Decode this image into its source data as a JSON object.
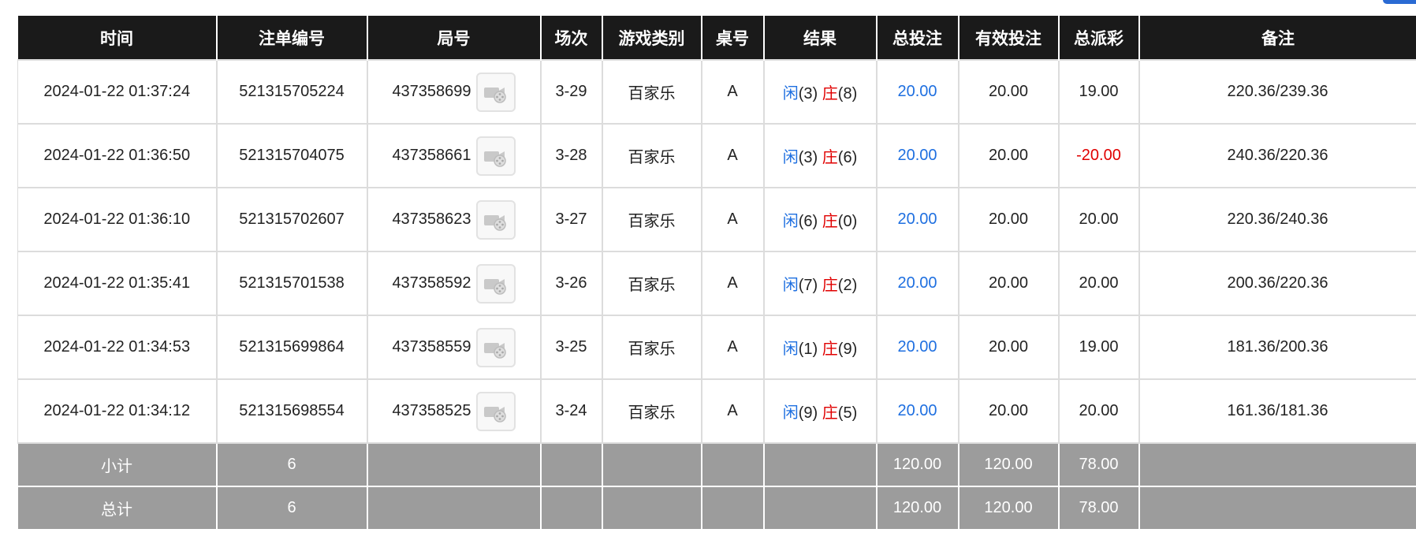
{
  "headers": [
    "时间",
    "注单编号",
    "局号",
    "场次",
    "游戏类别",
    "桌号",
    "结果",
    "总投注",
    "有效投注",
    "总派彩",
    "备注"
  ],
  "result_labels": {
    "player": "闲",
    "banker": "庄"
  },
  "colors": {
    "accent_blue": "#1e6fe0",
    "negative_red": "#e00000",
    "header_bg": "#1a1a1a",
    "total_bg": "#9c9c9c"
  },
  "rows": [
    {
      "time": "2024-01-22 01:37:24",
      "bet_id": "521315705224",
      "round_id": "437358699",
      "shoe": "3-29",
      "game_type": "百家乐",
      "table": "A",
      "player_score": "(3)",
      "banker_score": "(8)",
      "total_bet": "20.00",
      "valid_bet": "20.00",
      "payout": "19.00",
      "payout_negative": false,
      "remark": "220.36/239.36"
    },
    {
      "time": "2024-01-22 01:36:50",
      "bet_id": "521315704075",
      "round_id": "437358661",
      "shoe": "3-28",
      "game_type": "百家乐",
      "table": "A",
      "player_score": "(3)",
      "banker_score": "(6)",
      "total_bet": "20.00",
      "valid_bet": "20.00",
      "payout": "-20.00",
      "payout_negative": true,
      "remark": "240.36/220.36"
    },
    {
      "time": "2024-01-22 01:36:10",
      "bet_id": "521315702607",
      "round_id": "437358623",
      "shoe": "3-27",
      "game_type": "百家乐",
      "table": "A",
      "player_score": "(6)",
      "banker_score": "(0)",
      "total_bet": "20.00",
      "valid_bet": "20.00",
      "payout": "20.00",
      "payout_negative": false,
      "remark": "220.36/240.36"
    },
    {
      "time": "2024-01-22 01:35:41",
      "bet_id": "521315701538",
      "round_id": "437358592",
      "shoe": "3-26",
      "game_type": "百家乐",
      "table": "A",
      "player_score": "(7)",
      "banker_score": "(2)",
      "total_bet": "20.00",
      "valid_bet": "20.00",
      "payout": "20.00",
      "payout_negative": false,
      "remark": "200.36/220.36"
    },
    {
      "time": "2024-01-22 01:34:53",
      "bet_id": "521315699864",
      "round_id": "437358559",
      "shoe": "3-25",
      "game_type": "百家乐",
      "table": "A",
      "player_score": "(1)",
      "banker_score": "(9)",
      "total_bet": "20.00",
      "valid_bet": "20.00",
      "payout": "19.00",
      "payout_negative": false,
      "remark": "181.36/200.36"
    },
    {
      "time": "2024-01-22 01:34:12",
      "bet_id": "521315698554",
      "round_id": "437358525",
      "shoe": "3-24",
      "game_type": "百家乐",
      "table": "A",
      "player_score": "(9)",
      "banker_score": "(5)",
      "total_bet": "20.00",
      "valid_bet": "20.00",
      "payout": "20.00",
      "payout_negative": false,
      "remark": "161.36/181.36"
    }
  ],
  "subtotal": {
    "label": "小计",
    "count": "6",
    "total_bet": "120.00",
    "valid_bet": "120.00",
    "payout": "78.00"
  },
  "grandtotal": {
    "label": "总计",
    "count": "6",
    "total_bet": "120.00",
    "valid_bet": "120.00",
    "payout": "78.00"
  }
}
